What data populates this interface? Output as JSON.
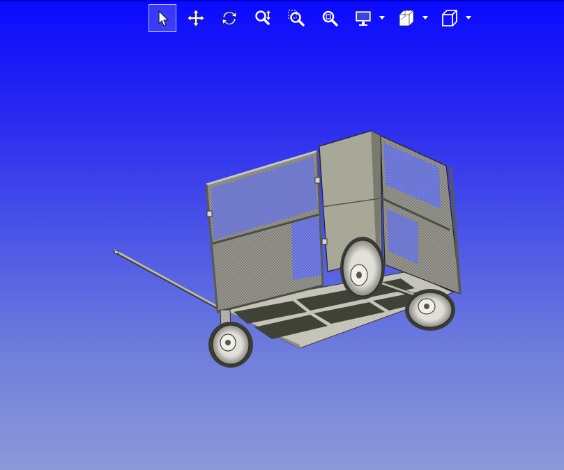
{
  "toolbar": {
    "tools": [
      {
        "name": "select-tool",
        "icon": "arrow-pointer-icon",
        "active": true
      },
      {
        "name": "pan-tool",
        "icon": "move-arrows-icon",
        "active": false
      },
      {
        "name": "rotate-tool",
        "icon": "rotate-icon",
        "active": false
      },
      {
        "name": "zoom-in-out-tool",
        "icon": "zoom-updown-icon",
        "active": false
      },
      {
        "name": "zoom-to-area-tool",
        "icon": "zoom-area-icon",
        "active": false
      },
      {
        "name": "zoom-to-fit-tool",
        "icon": "zoom-fit-icon",
        "active": false
      },
      {
        "name": "display-style-dropdown",
        "icon": "monitor-icon",
        "active": false
      },
      {
        "name": "section-view-dropdown",
        "icon": "section-view-icon",
        "active": false
      },
      {
        "name": "view-orientation-dropdown",
        "icon": "cube-icon",
        "active": false
      }
    ]
  },
  "viewport": {
    "model": "cart-3d-model",
    "background_top": "#0a0aff",
    "background_bottom": "#8d99d8"
  }
}
